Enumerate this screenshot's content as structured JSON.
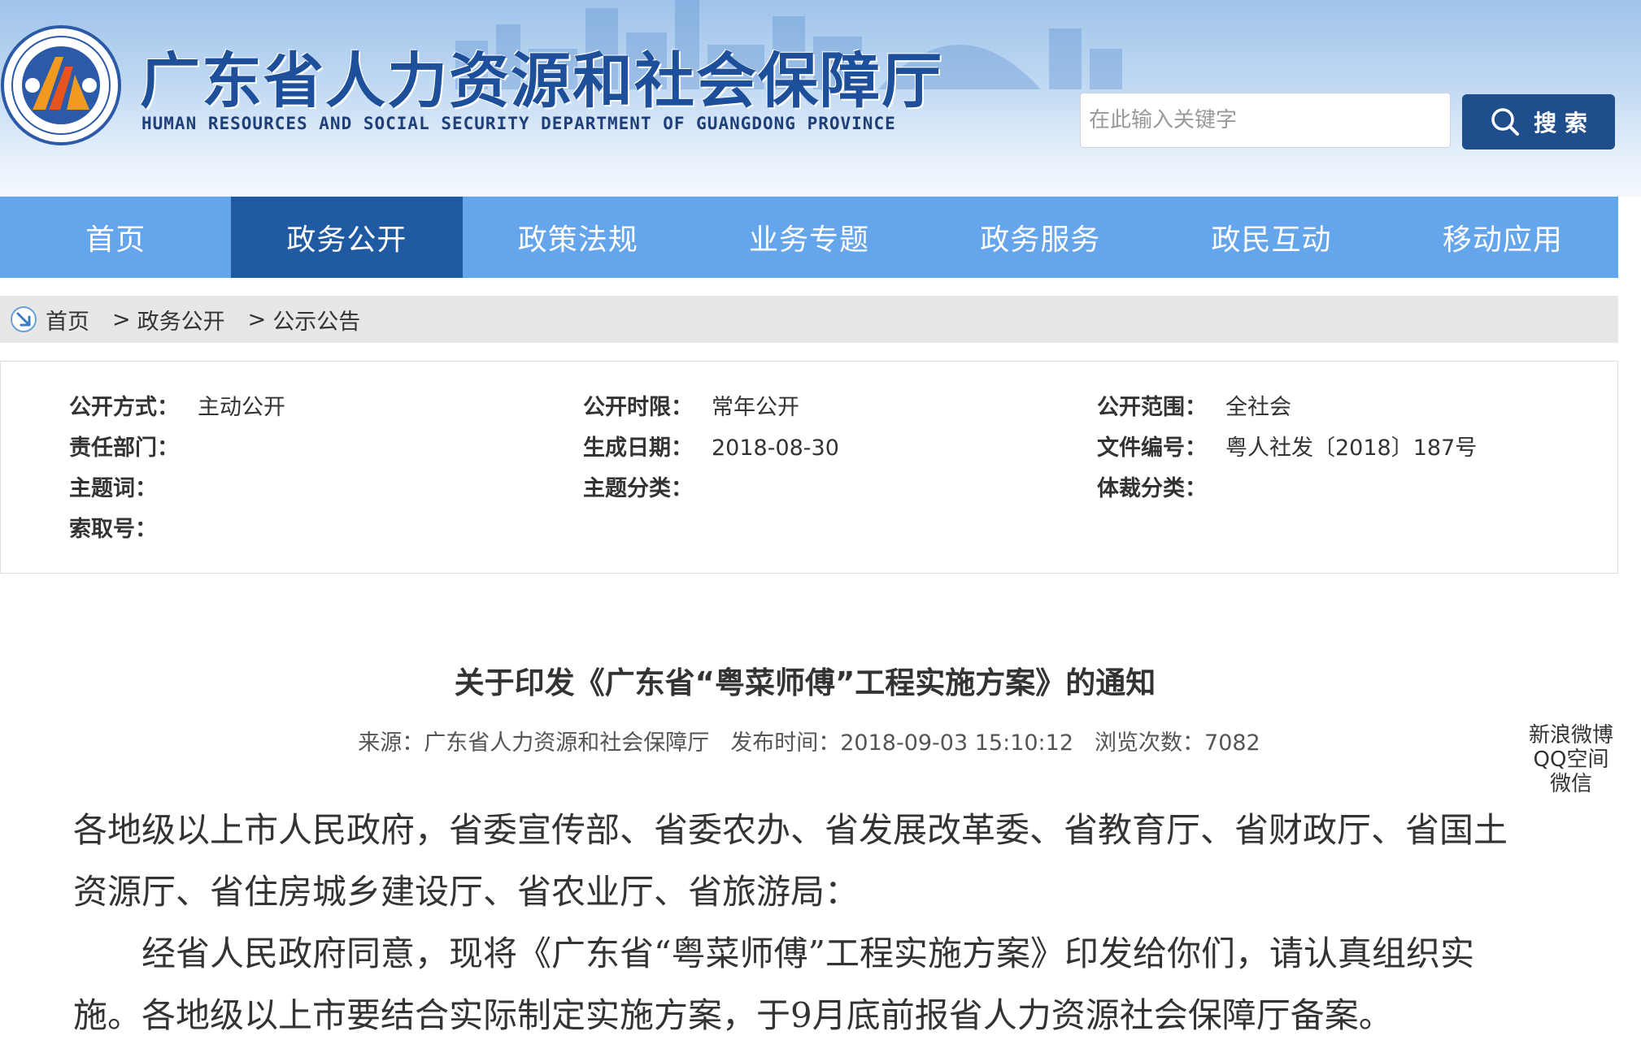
{
  "header": {
    "title": "广东省人力资源和社会保障厅",
    "subtitle": "HUMAN RESOURCES AND SOCIAL SECURITY DEPARTMENT OF GUANGDONG PROVINCE",
    "search_placeholder": "在此输入关键字",
    "search_button": "搜 索"
  },
  "nav": {
    "items": [
      {
        "label": "首页"
      },
      {
        "label": "政务公开"
      },
      {
        "label": "政策法规"
      },
      {
        "label": "业务专题"
      },
      {
        "label": "政务服务"
      },
      {
        "label": "政民互动"
      },
      {
        "label": "移动应用"
      }
    ],
    "active_index": 1
  },
  "breadcrumb": {
    "items": [
      "首页",
      "政务公开",
      "公示公告"
    ],
    "separator": ">"
  },
  "meta": {
    "mode": {
      "label": "公开方式：",
      "value": "主动公开"
    },
    "period": {
      "label": "公开时限：",
      "value": "常年公开"
    },
    "scope": {
      "label": "公开范围：",
      "value": "全社会"
    },
    "department": {
      "label": "责任部门：",
      "value": ""
    },
    "date": {
      "label": "生成日期：",
      "value": "2018-08-30"
    },
    "doc_no": {
      "label": "文件编号：",
      "value": "粤人社发〔2018〕187号"
    },
    "keywords": {
      "label": "主题词：",
      "value": ""
    },
    "topic": {
      "label": "主题分类：",
      "value": ""
    },
    "genre": {
      "label": "体裁分类：",
      "value": ""
    },
    "index_no": {
      "label": "索取号：",
      "value": ""
    }
  },
  "article": {
    "title": "关于印发《广东省“粤菜师傅”工程实施方案》的通知",
    "source_label": "来源：",
    "source": "广东省人力资源和社会保障厅",
    "publish_label": "发布时间：",
    "publish_time": "2018-09-03 15:10:12",
    "views_label": "浏览次数：",
    "views": "7082",
    "paragraphs": [
      "各地级以上市人民政府，省委宣传部、省委农办、省发展改革委、省教育厅、省财政厅、省国土资源厅、省住房城乡建设厅、省农业厅、省旅游局：",
      "经省人民政府同意，现将《广东省“粤菜师傅”工程实施方案》印发给你们，请认真组织实施。各地级以上市要结合实际制定实施方案，于9月底前报省人力资源社会保障厅备案。"
    ]
  },
  "share": {
    "weibo": "新浪微博",
    "qzone": "QQ空间",
    "wechat": "微信"
  },
  "colors": {
    "nav": "#65a5ec",
    "nav_active": "#1f5aa3",
    "search_button": "#1f4e8c",
    "title": "#1e4f9a"
  }
}
